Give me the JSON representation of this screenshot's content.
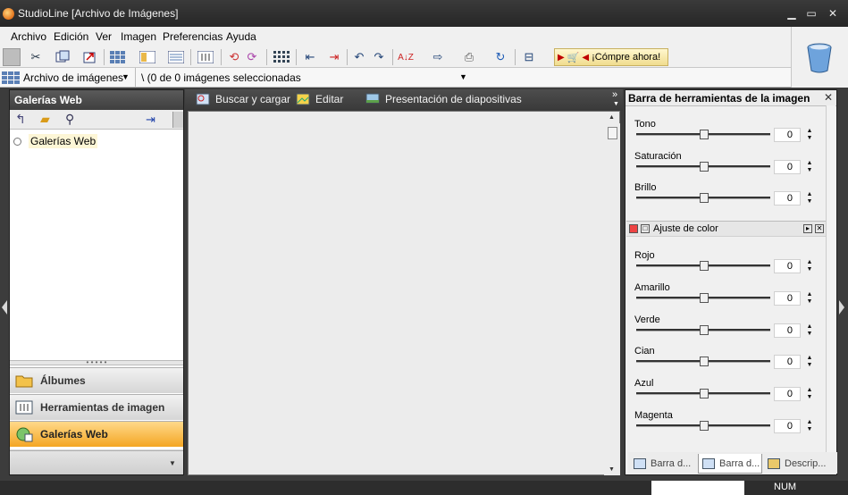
{
  "window": {
    "title": "StudioLine [Archivo de Imágenes]",
    "minimize": "▁",
    "maximize": "▭",
    "close": "✕"
  },
  "menu": [
    "Archivo",
    "Edición",
    "Ver",
    "Imagen",
    "Preferencias",
    "Ayuda"
  ],
  "toolbar": {
    "buy_label": "¡Cómpre ahora!"
  },
  "address": {
    "archive_label": "Archivo de imágenes",
    "path_label": "\\ (0 de 0 imágenes seleccionadas"
  },
  "left_panel": {
    "title": "Galerías Web",
    "tree_item": "Galerías Web",
    "tabs": [
      "Álbumes",
      "Herramientas de imagen",
      "Galerías Web"
    ],
    "active_tab": "Galerías Web"
  },
  "center": {
    "tabs": [
      "Buscar y cargar",
      "Editar",
      "Presentación de diapositivas"
    ]
  },
  "right_panel": {
    "title": "Barra de herramientas de la imagen",
    "sliders_top": [
      {
        "label": "Tono",
        "value": "0"
      },
      {
        "label": "Saturación",
        "value": "0"
      },
      {
        "label": "Brillo",
        "value": "0"
      }
    ],
    "color_section_title": "Ajuste de color",
    "sliders_color": [
      {
        "label": "Rojo",
        "value": "0"
      },
      {
        "label": "Amarillo",
        "value": "0"
      },
      {
        "label": "Verde",
        "value": "0"
      },
      {
        "label": "Cian",
        "value": "0"
      },
      {
        "label": "Azul",
        "value": "0"
      },
      {
        "label": "Magenta",
        "value": "0"
      }
    ],
    "tabs": [
      "Barra d...",
      "Barra d...",
      "Descrip..."
    ]
  },
  "status": {
    "num": "NUM"
  },
  "colors": {
    "active_tab": "#f4a623",
    "title_bar": "#262626",
    "panel_bg": "#f0f0f0"
  }
}
